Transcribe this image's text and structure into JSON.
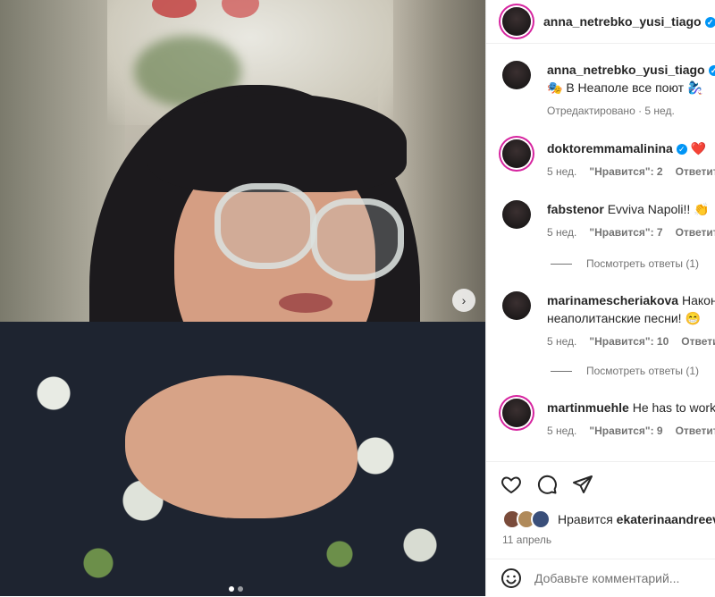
{
  "post": {
    "username": "anna_netrebko_yusi_tiago",
    "caption": "🎭 В Неаполе все поют 🧞‍♀️",
    "edited_label": "Отредактировано · 5 нед.",
    "carousel_next": "›"
  },
  "comments": [
    {
      "username": "doktoremmamalinina",
      "verified": true,
      "text": "❤️",
      "age": "5 нед.",
      "likes": "\"Нравится\": 2",
      "reply": "Ответить"
    },
    {
      "username": "fabstenor",
      "verified": false,
      "text": "Evviva Napoli!! 👏",
      "age": "5 нед.",
      "likes": "\"Нравится\": 7",
      "reply": "Ответить",
      "view_replies": "Посмотреть ответы (1)"
    },
    {
      "username": "marinamescheriakova",
      "verified": false,
      "text": "Наконе",
      "text2": "неаполитанские песни! 😁",
      "age": "5 нед.",
      "likes": "\"Нравится\": 10",
      "reply": "Ответить",
      "view_replies": "Посмотреть ответы (1)"
    },
    {
      "username": "martinmuehle",
      "verified": false,
      "text": "He has to work",
      "age": "5 нед.",
      "likes": "\"Нравится\": 9",
      "reply": "Ответить"
    }
  ],
  "likes": {
    "prefix": "Нравится",
    "user": "ekaterinaandreeva"
  },
  "date": "11 апрель",
  "add_comment_placeholder": "Добавьте комментарий...",
  "icons": {
    "heart": "heart-icon",
    "comment": "comment-icon",
    "share": "share-icon",
    "emoji": "emoji-icon"
  },
  "colors": {
    "verified": "#0095f6",
    "story_ring": "#d6249f",
    "muted": "#737373"
  }
}
